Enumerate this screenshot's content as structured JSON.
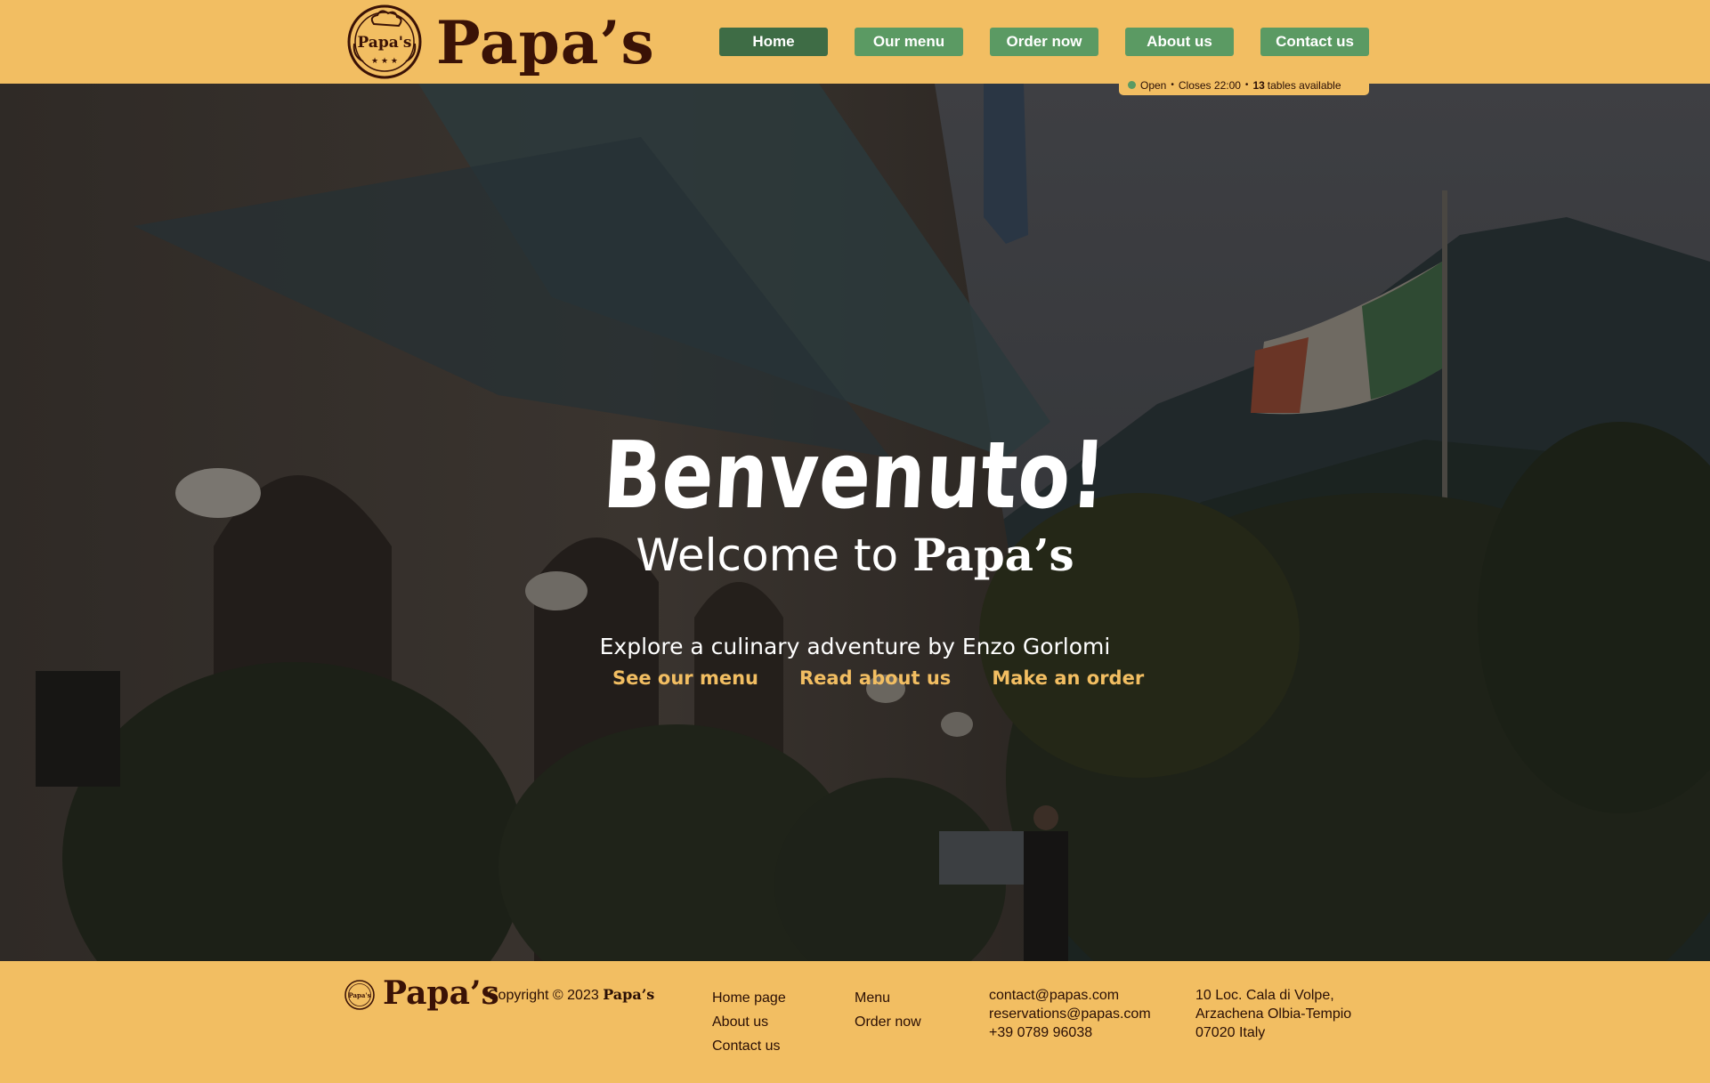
{
  "header": {
    "logo_text": "Papa's",
    "brand": "Papa’s",
    "nav": [
      {
        "label": "Home",
        "active": true
      },
      {
        "label": "Our menu"
      },
      {
        "label": "Order now"
      },
      {
        "label": "About us"
      },
      {
        "label": "Contact us"
      }
    ],
    "status": {
      "open": "Open",
      "closes": "Closes 22:00",
      "tables_count": "13",
      "tables_text": "tables available"
    }
  },
  "hero": {
    "title": "Benvenuto!",
    "subtitle_prefix": "Welcome to",
    "subtitle_brand": "Papa’s",
    "tagline": "Explore a culinary adventure by Enzo Gorlomi",
    "links": [
      "See our menu",
      "Read about us",
      "Make an order"
    ]
  },
  "footer": {
    "brand": "Papa’s",
    "copyright_prefix": "Copyright © 2023",
    "copyright_brand": "Papa’s",
    "col1": [
      "Home page",
      "About us",
      "Contact us"
    ],
    "col2": [
      "Menu",
      "Order now"
    ],
    "contact": [
      "contact@papas.com",
      "reservations@papas.com",
      "+39 0789 96038"
    ],
    "address": [
      "10 Loc. Cala di Volpe,",
      "Arzachena Olbia-Tempio",
      "07020 Italy"
    ]
  },
  "colors": {
    "background": "#f2be62",
    "nav_button": "#5b9a63",
    "nav_button_active": "#3e6c45",
    "brand_text": "#3a1206",
    "hero_link": "#f2be62"
  },
  "icons": [
    "chef-hat-logo-icon",
    "status-dot-icon"
  ]
}
